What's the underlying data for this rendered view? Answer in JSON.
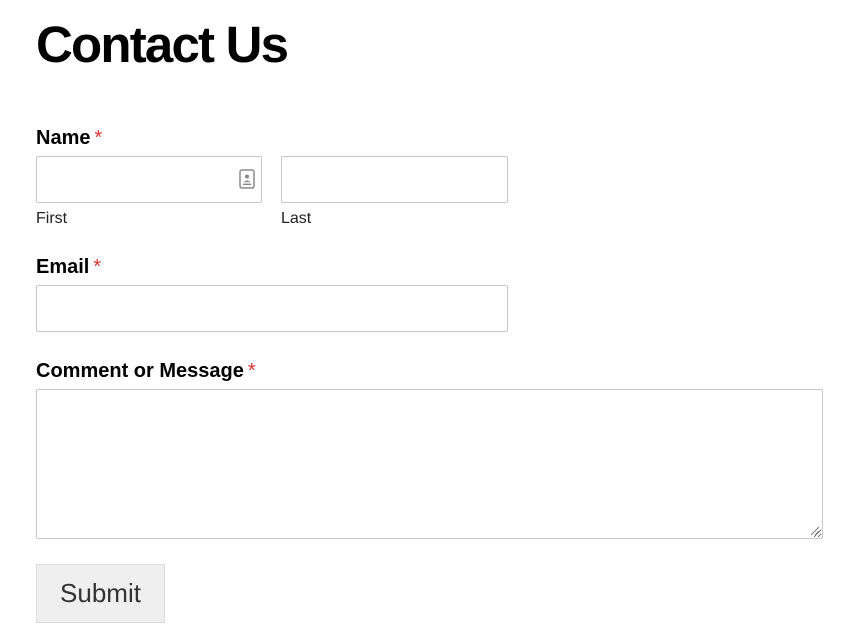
{
  "page": {
    "title": "Contact Us"
  },
  "form": {
    "required_marker": "*",
    "name": {
      "label": "Name",
      "first": {
        "value": "",
        "placeholder": "",
        "sublabel": "First"
      },
      "last": {
        "value": "",
        "placeholder": "",
        "sublabel": "Last"
      }
    },
    "email": {
      "label": "Email",
      "value": "",
      "placeholder": ""
    },
    "message": {
      "label": "Comment or Message",
      "value": "",
      "placeholder": ""
    },
    "submit_label": "Submit"
  },
  "icons": {
    "autofill": "contact-card-icon",
    "resize": "resize-grip-icon"
  },
  "colors": {
    "required": "#dd3333",
    "input_border": "#c8c8c8",
    "button_bg": "#efefef",
    "button_text": "#333333"
  }
}
